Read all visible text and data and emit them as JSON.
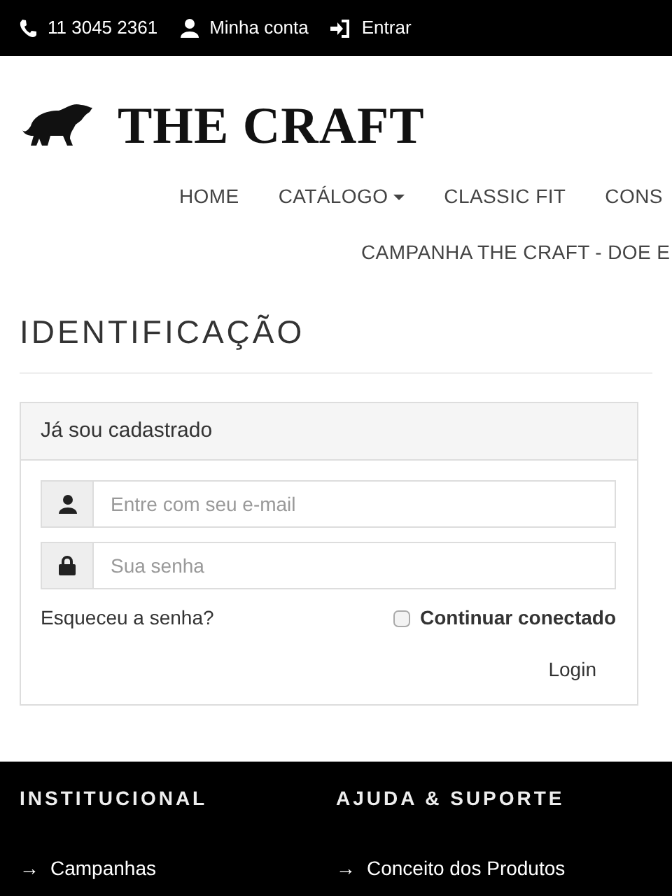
{
  "top_bar": {
    "phone": "11 3045 2361",
    "account": "Minha conta",
    "login": "Entrar"
  },
  "brand": {
    "name": "THE CRAFT"
  },
  "nav": {
    "main_links": [
      {
        "label": "HOME",
        "dropdown": false
      },
      {
        "label": "CATÁLOGO",
        "dropdown": true
      },
      {
        "label": "CLASSIC FIT",
        "dropdown": false
      },
      {
        "label": "CONS",
        "dropdown": false
      }
    ],
    "campaign_link": {
      "label": "CAMPANHA THE CRAFT - DOE E"
    }
  },
  "page_title": "IDENTIFICAÇÃO",
  "login_card": {
    "title": "Já sou cadastrado",
    "email": {
      "placeholder": "Entre com seu e-mail"
    },
    "password": {
      "placeholder": "Sua senha"
    },
    "forgot": "Esqueceu a senha?",
    "remember": {
      "label": "Continuar conectado",
      "checked": false
    },
    "submit": "Login"
  },
  "footer": {
    "columns": [
      {
        "title": "INSTITUCIONAL",
        "links": [
          {
            "arrow": "→",
            "label": "Campanhas"
          }
        ]
      },
      {
        "title": "AJUDA & SUPORTE",
        "links": [
          {
            "arrow": "→",
            "label": "Conceito dos Produtos"
          }
        ]
      }
    ]
  }
}
